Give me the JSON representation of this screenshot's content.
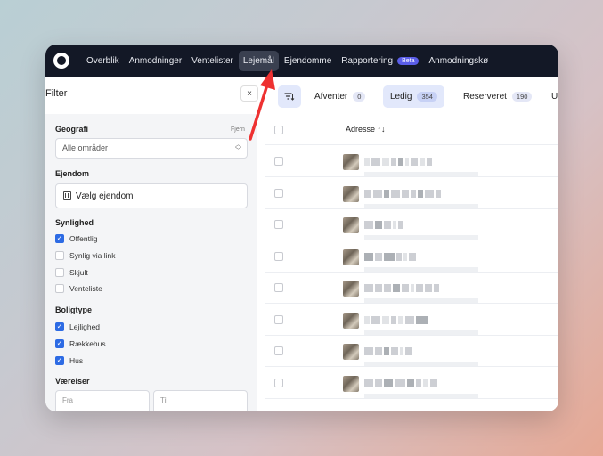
{
  "nav": {
    "items": [
      {
        "label": "Overblik",
        "active": false
      },
      {
        "label": "Anmodninger",
        "active": false
      },
      {
        "label": "Ventelister",
        "active": false
      },
      {
        "label": "Lejemål",
        "active": true
      },
      {
        "label": "Ejendomme",
        "active": false
      },
      {
        "label": "Rapportering",
        "active": false,
        "badge": "Beta"
      },
      {
        "label": "Anmodningskø",
        "active": false
      }
    ]
  },
  "filter": {
    "title": "Filter",
    "close_label": "×",
    "geografi": {
      "label": "Geografi",
      "clear": "Fjern",
      "value": "Alle områder"
    },
    "ejendom": {
      "label": "Ejendom",
      "placeholder": "Vælg ejendom"
    },
    "synlighed": {
      "label": "Synlighed",
      "options": [
        {
          "label": "Offentlig",
          "checked": true
        },
        {
          "label": "Synlig via link",
          "checked": false
        },
        {
          "label": "Skjult",
          "checked": false
        },
        {
          "label": "Venteliste",
          "checked": false
        }
      ]
    },
    "boligtype": {
      "label": "Boligtype",
      "options": [
        {
          "label": "Lejlighed",
          "checked": true
        },
        {
          "label": "Rækkehus",
          "checked": true
        },
        {
          "label": "Hus",
          "checked": true
        }
      ]
    },
    "vaerelser": {
      "label": "Værelser",
      "from_placeholder": "Fra",
      "to_placeholder": "Til"
    }
  },
  "tabs": [
    {
      "label": "Afventer",
      "count": "0",
      "active": false
    },
    {
      "label": "Ledig",
      "count": "354",
      "active": true
    },
    {
      "label": "Reserveret",
      "count": "190",
      "active": false
    },
    {
      "label": "U",
      "count": "",
      "active": false
    }
  ],
  "table": {
    "columns": [
      "Adresse ↑↓"
    ],
    "row_count": 8
  },
  "colors": {
    "accent": "#2d6be4",
    "topbar": "#131826",
    "arrow": "#ee3131"
  }
}
